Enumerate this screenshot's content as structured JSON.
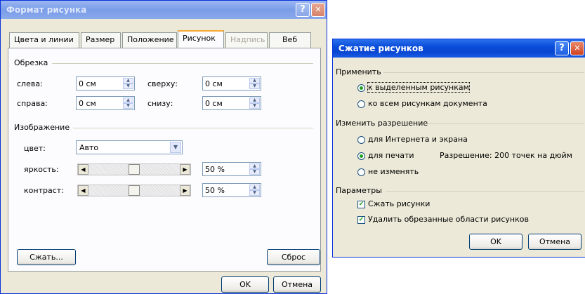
{
  "format_dialog": {
    "title": "Формат рисунка",
    "help_glyph": "?",
    "close_glyph": "✕",
    "tabs": [
      {
        "label": "Цвета и линии",
        "state": "normal"
      },
      {
        "label": "Размер",
        "state": "normal"
      },
      {
        "label": "Положение",
        "state": "normal"
      },
      {
        "label": "Рисунок",
        "state": "active"
      },
      {
        "label": "Надпись",
        "state": "disabled"
      },
      {
        "label": "Веб",
        "state": "normal"
      }
    ],
    "crop": {
      "group_label": "Обрезка",
      "left_label": "слева:",
      "left_value": "0 см",
      "right_label": "справа:",
      "right_value": "0 см",
      "top_label": "сверху:",
      "top_value": "0 см",
      "bottom_label": "снизу:",
      "bottom_value": "0 см"
    },
    "image": {
      "group_label": "Изображение",
      "color_label": "цвет:",
      "color_value": "Авто",
      "brightness_label": "яркость:",
      "brightness_value": "50 %",
      "brightness_level": 0.5,
      "contrast_label": "контраст:",
      "contrast_value": "50 %",
      "contrast_level": 0.5
    },
    "compress_button": "Сжать...",
    "reset_button": "Сброс",
    "ok_button": "OK",
    "cancel_button": "Отмена"
  },
  "compress_dialog": {
    "title": "Сжатие рисунков",
    "help_glyph": "?",
    "close_glyph": "✕",
    "apply_group": "Применить",
    "apply_options": [
      {
        "label": "к выделенным рисункам",
        "selected": true
      },
      {
        "label": "ко всем рисункам документа",
        "selected": false
      }
    ],
    "resolution_group": "Изменить разрешение",
    "resolution_options": [
      {
        "label": "для Интернета и экрана",
        "selected": false
      },
      {
        "label": "для печати",
        "selected": true
      },
      {
        "label": "не изменять",
        "selected": false
      }
    ],
    "resolution_text": "Разрешение:  200 точек на дюйм",
    "params_group": "Параметры",
    "compress_checkbox": "Сжать рисунки",
    "delete_cropped_checkbox": "Удалить обрезанные области рисунков",
    "ok_button": "OK",
    "cancel_button": "Отмена"
  }
}
